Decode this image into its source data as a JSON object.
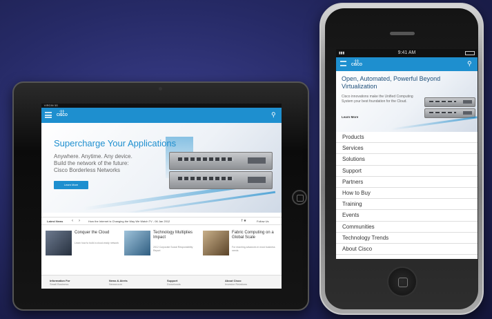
{
  "ipad": {
    "status_left": " VIRGIN 3G",
    "hero_title": "Supercharge Your Applications",
    "hero_sub": [
      "Anywhere. Anytime. Any device.",
      "Build the network of the future:",
      "Cisco Borderless Networks"
    ],
    "hero_button": "Learn More",
    "news_label": "Latest News",
    "news_text": "How the Internet is Changing the Way We Watch TV - 06 Jan 2012",
    "follow_label": "Follow Us",
    "social": "f ★",
    "cards": [
      {
        "title": "Conquer the Cloud",
        "sub": "Learn how to build a cloud-ready network"
      },
      {
        "title": "Technology Multiplies Impact",
        "sub": "2012 Corporate Social Responsibility Report"
      },
      {
        "title": "Fabric Computing on a Global Scale",
        "sub": "For reaching advances in most business needs"
      }
    ],
    "footer": [
      {
        "head": "Information For",
        "sub": "Small Business"
      },
      {
        "head": "News & Alerts",
        "sub": "Newsroom"
      },
      {
        "head": "Support",
        "sub": "Downloads"
      },
      {
        "head": "About Cisco",
        "sub": "Investor Relations"
      }
    ]
  },
  "brand": {
    "logo_top": "·|·|·",
    "logo_name": "CISCO",
    "accent": "#1e8fcf"
  },
  "iphone": {
    "status_time": "9:41 AM",
    "hero_title": "Open, Automated, Powerful Beyond Virtualization",
    "hero_sub": "Cisco innovations make the Unified Computing System your best foundation for the Cloud.",
    "hero_link": "Learn More",
    "menu": [
      "Products",
      "Services",
      "Solutions",
      "Support",
      "Partners",
      "How to Buy",
      "Training",
      "Events",
      "Communities",
      "Technology Trends",
      "About Cisco"
    ]
  },
  "icons": {
    "menu": "menu-icon",
    "search": "search-icon",
    "prev": "chevron-left-icon",
    "next": "chevron-right-icon",
    "home": "home-button-icon"
  }
}
